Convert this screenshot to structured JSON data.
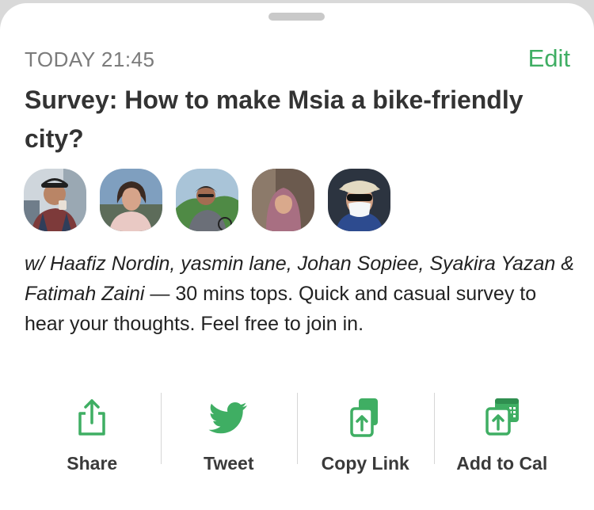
{
  "event": {
    "date": "TODAY 21:45",
    "edit_label": "Edit",
    "title": "Survey: How to make Msia a bike-friendly city?"
  },
  "participants": [
    {
      "name": "Haafiz Nordin"
    },
    {
      "name": "yasmin lane"
    },
    {
      "name": "Johan Sopiee"
    },
    {
      "name": "Syakira Yazan"
    },
    {
      "name": "Fatimah Zaini"
    }
  ],
  "description": {
    "names_text": "w/ Haafiz Nordin, yasmin lane, Johan Sopiee, Syakira Yazan & Fatimah Zaini",
    "rest_text": " — 30 mins tops. Quick and casual survey to hear your thoughts. Feel free to join in."
  },
  "actions": [
    {
      "label": "Share",
      "icon": "share-icon"
    },
    {
      "label": "Tweet",
      "icon": "twitter-bird-icon"
    },
    {
      "label": "Copy Link",
      "icon": "copy-link-icon"
    },
    {
      "label": "Add to Cal",
      "icon": "add-to-calendar-icon"
    }
  ],
  "colors": {
    "accent": "#3fae63",
    "title": "#333333",
    "muted": "#7b7b7b"
  }
}
